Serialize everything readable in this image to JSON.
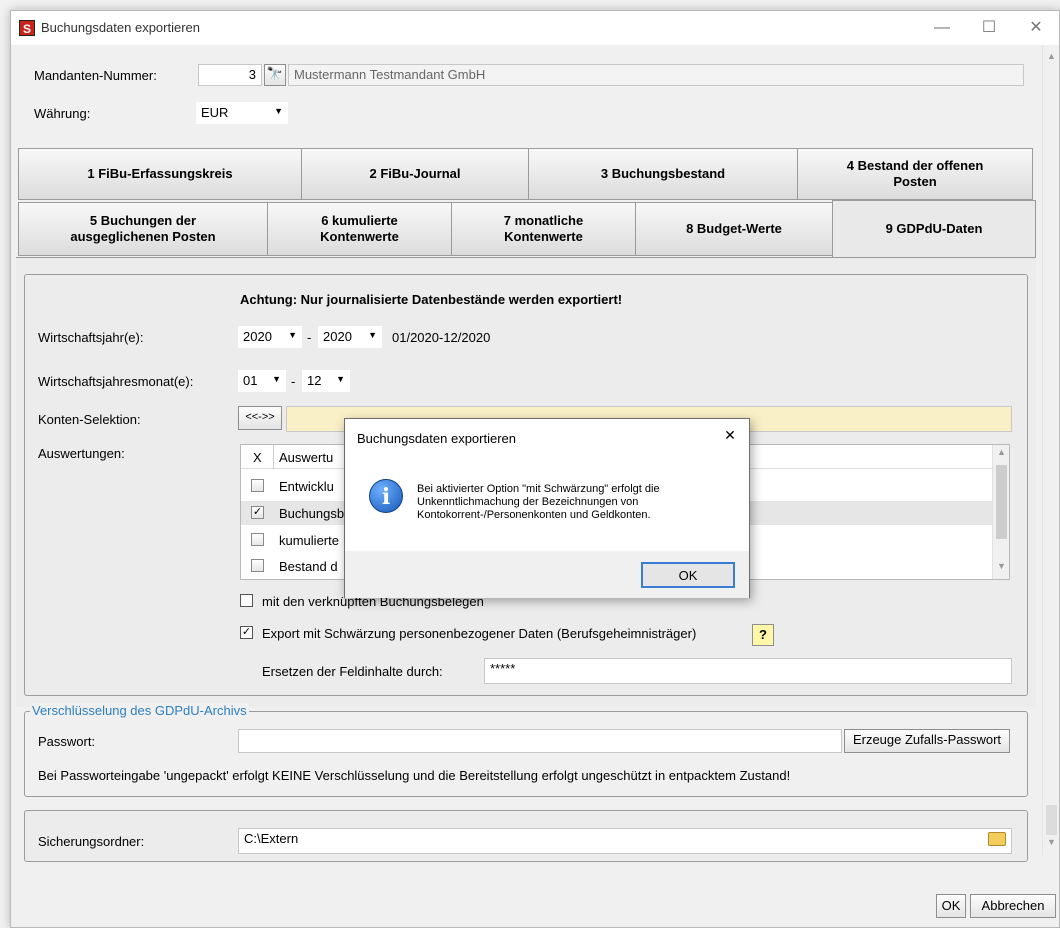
{
  "window": {
    "title": "Buchungsdaten exportieren",
    "app_icon": "S",
    "minimize": "—",
    "maximize": "☐",
    "close": "✕"
  },
  "header": {
    "mandant_label": "Mandanten-Nummer:",
    "mandant_number": "3",
    "mandant_name": "Mustermann Testmandant GmbH",
    "currency_label": "Währung:",
    "currency_value": "EUR"
  },
  "tabs_row1": [
    {
      "label": "1 FiBu-Erfassungskreis"
    },
    {
      "label": "2 FiBu-Journal"
    },
    {
      "label": "3 Buchungsbestand"
    },
    {
      "label": "4 Bestand der offenen Posten"
    }
  ],
  "tabs_row2": [
    {
      "label": "5 Buchungen der ausgeglichenen Posten"
    },
    {
      "label": "6 kumulierte Kontenwerte"
    },
    {
      "label": "7 monatliche Kontenwerte"
    },
    {
      "label": "8 Budget-Werte"
    },
    {
      "label": "9 GDPdU-Daten",
      "active": true
    }
  ],
  "gdpdu": {
    "warning": "Achtung: Nur journalisierte Datenbestände werden exportiert!",
    "fiscal_year_label": "Wirtschaftsjahr(e):",
    "year_from": "2020",
    "year_to": "2020",
    "dash": "-",
    "period_text": "01/2020-12/2020",
    "fiscal_month_label": "Wirtschaftsjahresmonat(e):",
    "month_from": "01",
    "month_to": "12",
    "account_selection_label": "Konten-Selektion:",
    "account_selection_button": "<<->>",
    "evaluations_label": "Auswertungen:",
    "grid_header_x": "X",
    "grid_header_name": "Auswertu",
    "grid_rows": [
      {
        "checked": false,
        "name": "Entwicklu"
      },
      {
        "checked": true,
        "name": "Buchungsb"
      },
      {
        "checked": false,
        "name": "kumulierte"
      },
      {
        "checked": false,
        "name": "Bestand d"
      }
    ],
    "link_receipts_label": "mit den verknüpften Buchungsbelegen",
    "export_redaction_label": "Export mit Schwärzung personenbezogener Daten (Berufsgeheimnisträger)",
    "help_icon": "?",
    "replace_label": "Ersetzen der Feldinhalte durch:",
    "replace_value": "*****"
  },
  "encryption": {
    "legend": "Verschlüsselung des GDPdU-Archivs",
    "password_label": "Passwort:",
    "password_value": "",
    "generate_button": "Erzeuge Zufalls-Passwort",
    "note": "Bei Passworteingabe 'ungepackt' erfolgt KEINE Verschlüsselung und die Bereitstellung erfolgt ungeschützt in entpacktem Zustand!"
  },
  "backup": {
    "folder_label": "Sicherungsordner:",
    "folder_value": "C:\\Extern"
  },
  "footer": {
    "ok": "OK",
    "cancel": "Abbrechen"
  },
  "dialog": {
    "title": "Buchungsdaten exportieren",
    "close": "✕",
    "icon": "i",
    "message_line1": "Bei aktivierter Option \"mit Schwärzung\" erfolgt die",
    "message_line2": "Unkenntlichmachung der Bezeichnungen von",
    "message_line3": "Kontokorrent-/Personenkonten und Geldkonten.",
    "ok": "OK"
  }
}
